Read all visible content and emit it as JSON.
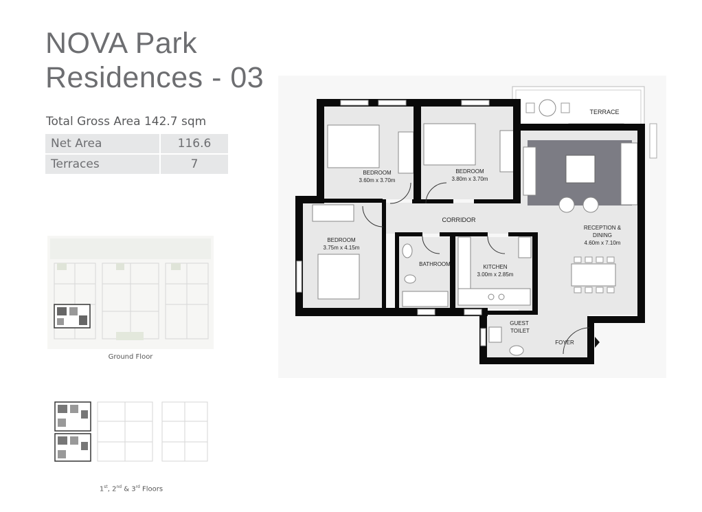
{
  "title": {
    "line1": "NOVA Park",
    "line2": "Residences - 03"
  },
  "total_gross_area": "Total Gross Area 142.7 sqm",
  "areas": [
    {
      "label": "Net Area",
      "value": "116.6"
    },
    {
      "label": "Terraces",
      "value": "7"
    }
  ],
  "keyplans": {
    "ground": "Ground Floor",
    "upper": {
      "n1": "1",
      "s1": "st",
      "n2": ", 2",
      "s2": "nd",
      "n3": " & 3",
      "s3": "rd",
      "tail": " Floors"
    }
  },
  "rooms": {
    "terrace": "TERRACE",
    "bedroom1": {
      "name": "BEDROOM",
      "dims": "3.60m x 3.70m"
    },
    "bedroom2": {
      "name": "BEDROOM",
      "dims": "3.80m x 3.70m"
    },
    "bedroom3": {
      "name": "BEDROOM",
      "dims": "3.75m x 4.15m"
    },
    "corridor": "CORRIDOR",
    "reception": {
      "line1": "RECEPTION &",
      "line2": "DINING",
      "dims": "4.60m x 7.10m"
    },
    "bathroom": "BATHROOM",
    "kitchen": {
      "name": "KITCHEN",
      "dims": "3.00m x 2.85m"
    },
    "guest_toilet": {
      "line1": "GUEST",
      "line2": "TOILET"
    },
    "foyer": "FOYER"
  },
  "colors": {
    "wall": "#0a0a0a",
    "floor": "#e8e8e8",
    "rug": "#7c7c84",
    "title": "#6d6e71",
    "table": "#e6e7e8"
  }
}
